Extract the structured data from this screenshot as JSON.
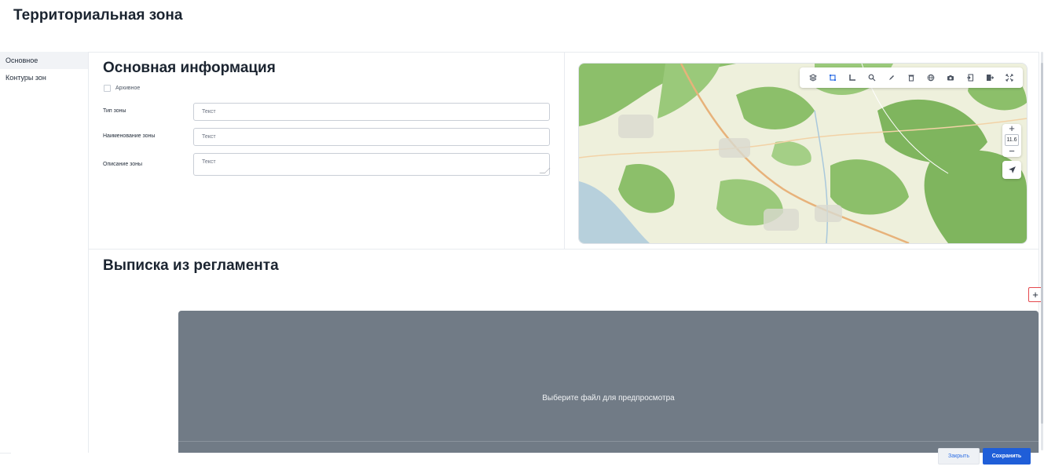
{
  "page": {
    "title": "Территориальная зона"
  },
  "sidebar": {
    "items": [
      {
        "label": "Основное",
        "active": true
      },
      {
        "label": "Контуры зон",
        "active": false
      }
    ]
  },
  "main_info": {
    "title": "Основная информация",
    "archived_label": "Архивное",
    "fields": [
      {
        "label": "Тип зоны",
        "placeholder": "Текст"
      },
      {
        "label": "Наименование зоны",
        "placeholder": "Текст"
      },
      {
        "label": "Описание зоны",
        "placeholder": "Текст"
      }
    ]
  },
  "map": {
    "zoom_level": "11.6",
    "zoom_in": "+",
    "zoom_out": "−",
    "tools": [
      "layers-icon",
      "select-rect-icon",
      "ruler-icon",
      "search-icon",
      "pencil-icon",
      "trash-icon",
      "globe-icon",
      "camera-icon",
      "import-icon",
      "export-icon",
      "fullscreen-icon"
    ],
    "colors": {
      "land": "#eef0dc",
      "forest": "#8cbf6a",
      "road": "#e7b27a",
      "water": "#a9c8dc"
    }
  },
  "regulation": {
    "title": "Выписка из регламента",
    "add_label": "+",
    "preview_text": "Выберите файл для предпросмотра"
  },
  "footer": {
    "close_label": "Закрыть",
    "save_label": "Сохранить"
  },
  "colors": {
    "accent": "#1f5ed8",
    "preview_bg": "#717b86",
    "add_border": "#e5484d"
  }
}
